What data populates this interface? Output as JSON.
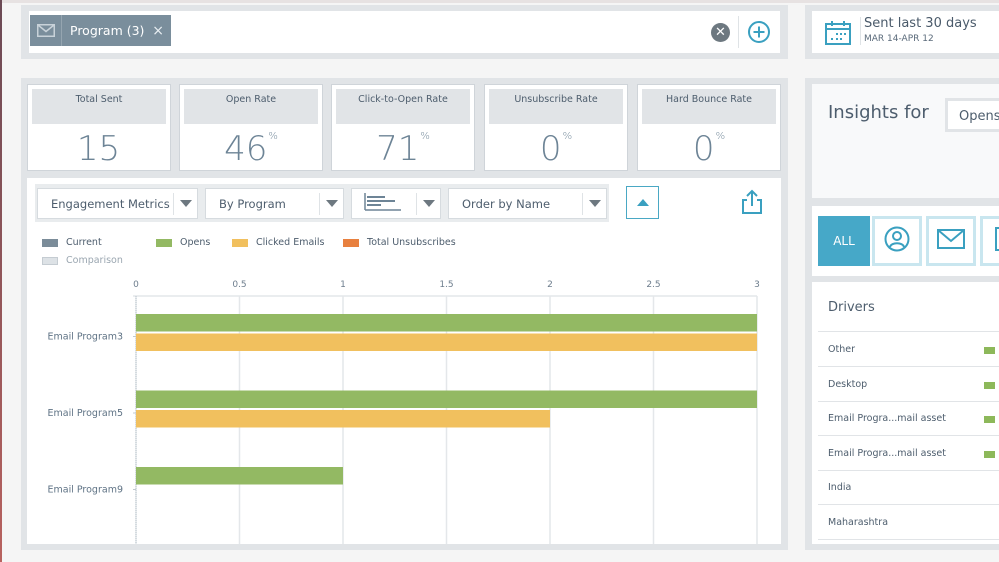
{
  "filter": {
    "chip_icon": "envelope-icon",
    "chip_label": "Program (3)",
    "chip_close": "×",
    "clear_icon": "clear-circle-icon",
    "clear_glyph": "✕",
    "add_icon": "add-circle-icon"
  },
  "date_range": {
    "icon": "calendar-icon",
    "title": "Sent last 30 days",
    "subtitle": "MAR 14-APR 12"
  },
  "kpis": [
    {
      "label": "Total Sent",
      "value": "15",
      "unit": ""
    },
    {
      "label": "Open Rate",
      "value": "46",
      "unit": "%"
    },
    {
      "label": "Click-to-Open Rate",
      "value": "71",
      "unit": "%"
    },
    {
      "label": "Unsubscribe Rate",
      "value": "0",
      "unit": "%"
    },
    {
      "label": "Hard Bounce Rate",
      "value": "0",
      "unit": "%"
    }
  ],
  "toolbar": {
    "metric_select": "Engagement Metrics",
    "group_select": "By Program",
    "chart_type_icon": "bar-chart-icon",
    "order_select": "Order by Name",
    "sort_icon": "sort-ascending-icon",
    "share_icon": "share-export-icon"
  },
  "legend": {
    "current": "Current",
    "comparison": "Comparison",
    "opens": "Opens",
    "clicked": "Clicked Emails",
    "unsubscribes": "Total Unsubscribes"
  },
  "colors": {
    "current": "#7b8c99",
    "comparison": "#dde2e6",
    "opens": "#93b963",
    "clicked": "#f1c05e",
    "unsubscribes": "#e8803f",
    "accent": "#46a8c8"
  },
  "chart_data": {
    "type": "bar",
    "orientation": "horizontal",
    "title": "",
    "xlabel": "",
    "ylabel": "",
    "xlim": [
      0,
      3
    ],
    "x_ticks": [
      "0",
      "0.5",
      "1",
      "1.5",
      "2",
      "2.5",
      "3"
    ],
    "grid": true,
    "legend_position": "top-left",
    "categories": [
      "Email Program3",
      "Email Program5",
      "Email Program9"
    ],
    "series": [
      {
        "name": "Opens",
        "values": [
          3,
          3,
          1
        ]
      },
      {
        "name": "Clicked Emails",
        "values": [
          3,
          2,
          0
        ]
      },
      {
        "name": "Total Unsubscribes",
        "values": [
          0,
          0,
          0
        ]
      }
    ]
  },
  "insights": {
    "title": "Insights for",
    "select_value": "Opens",
    "tabs": [
      {
        "label": "ALL",
        "icon": ""
      },
      {
        "label": "",
        "icon": "person-icon"
      },
      {
        "label": "",
        "icon": "envelope-icon"
      },
      {
        "label": "",
        "icon": "device-icon"
      }
    ],
    "drivers_title": "Drivers",
    "drivers": [
      {
        "label": "Other",
        "has_bar": true
      },
      {
        "label": "Desktop",
        "has_bar": true
      },
      {
        "label": "Email Progra...mail asset",
        "has_bar": true
      },
      {
        "label": "Email Progra...mail asset",
        "has_bar": true
      },
      {
        "label": "India",
        "has_bar": false
      },
      {
        "label": "Maharashtra",
        "has_bar": false
      }
    ]
  }
}
